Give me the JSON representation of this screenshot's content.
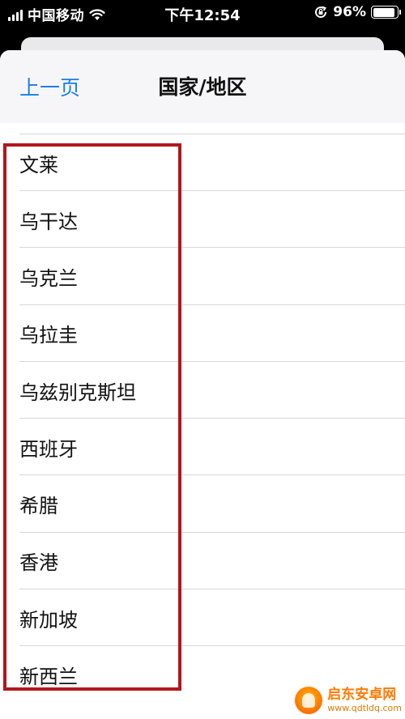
{
  "status_bar": {
    "carrier": "中国移动",
    "time": "下午12:54",
    "battery_percent": "96%",
    "battery_level": 0.96
  },
  "nav": {
    "back_label": "上一页",
    "title": "国家/地区"
  },
  "countries": [
    "文莱",
    "乌干达",
    "乌克兰",
    "乌拉圭",
    "乌兹别克斯坦",
    "西班牙",
    "希腊",
    "香港",
    "新加坡",
    "新西兰"
  ],
  "watermark": {
    "name": "启东安卓网",
    "url": "www.qdtldq.com"
  },
  "colors": {
    "accent": "#1a7fe6",
    "highlight": "#b1171b"
  }
}
